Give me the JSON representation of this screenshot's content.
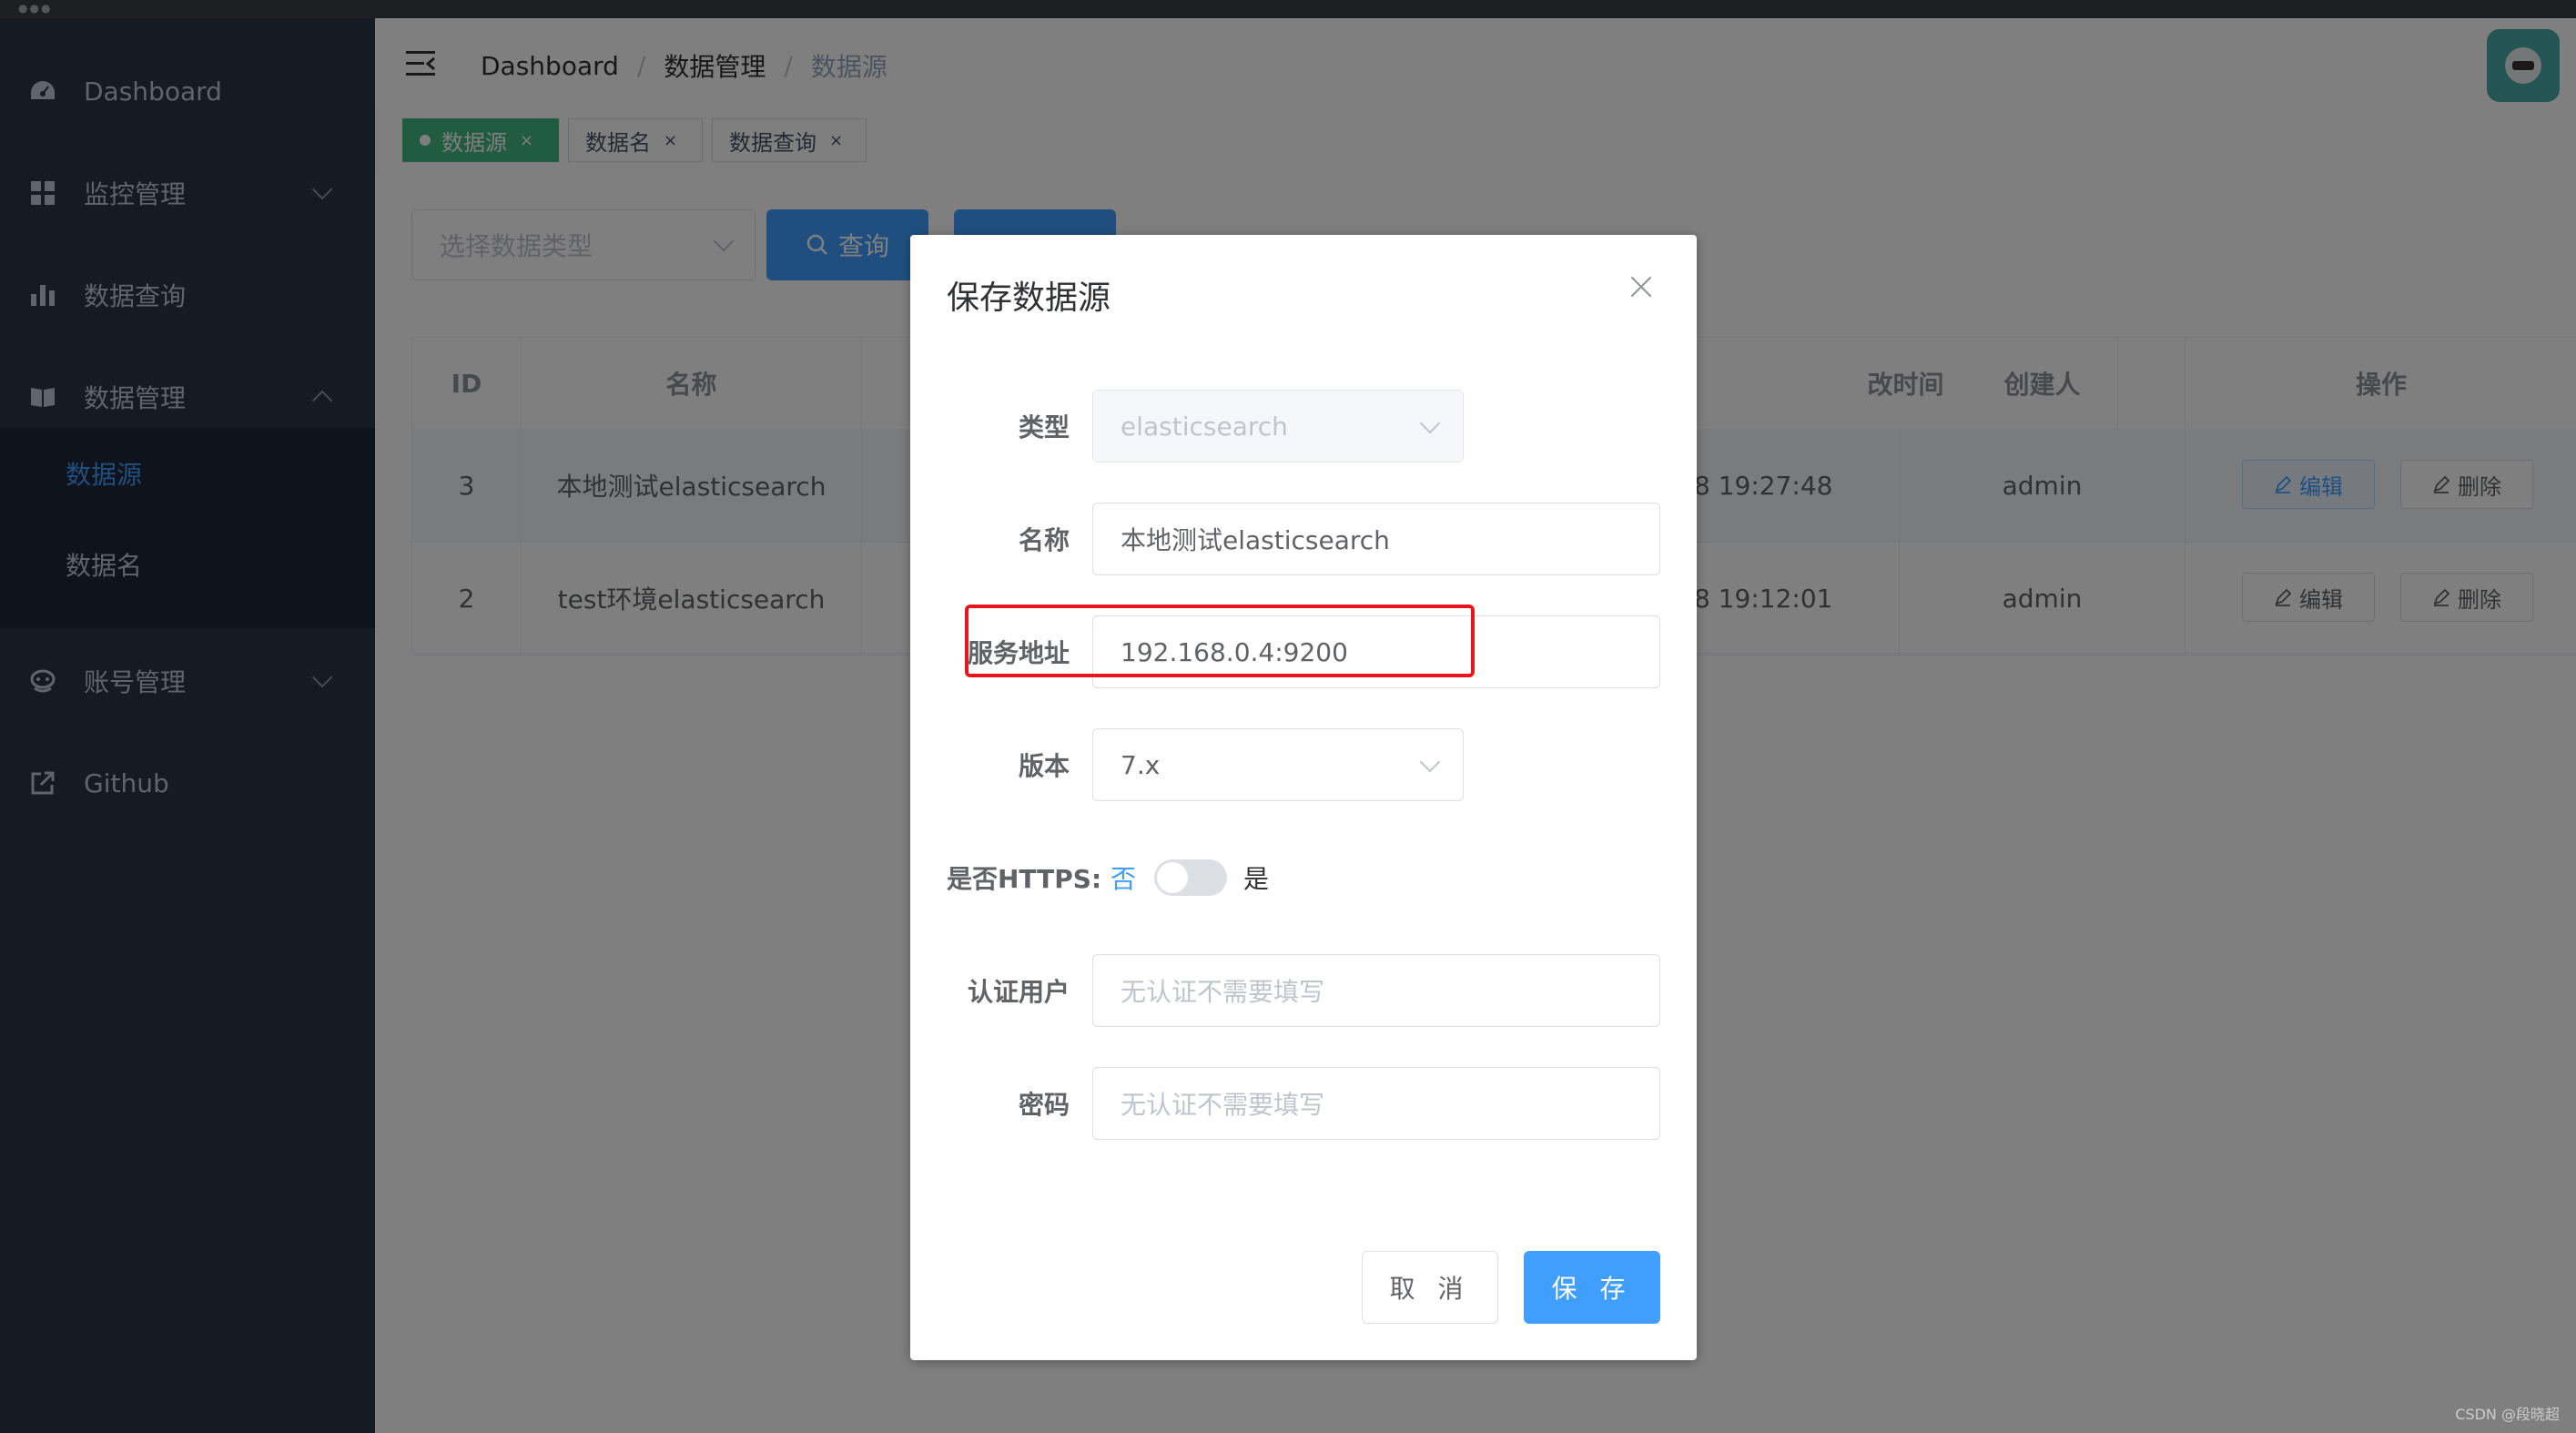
{
  "sidebar": {
    "items": [
      {
        "label": "Dashboard",
        "icon": "dashboard-icon"
      },
      {
        "label": "监控管理",
        "icon": "grid-icon"
      },
      {
        "label": "数据查询",
        "icon": "bar-chart-icon"
      },
      {
        "label": "数据管理",
        "icon": "book-icon"
      },
      {
        "label": "账号管理",
        "icon": "user-icon"
      },
      {
        "label": "Github",
        "icon": "external-link-icon"
      }
    ],
    "submenu": [
      {
        "label": "数据源",
        "active": true
      },
      {
        "label": "数据名",
        "active": false
      }
    ]
  },
  "header": {
    "breadcrumb": [
      "Dashboard",
      "数据管理",
      "数据源"
    ],
    "separator": "/"
  },
  "tags": [
    {
      "label": "数据源",
      "active": true
    },
    {
      "label": "数据名",
      "active": false
    },
    {
      "label": "数据查询",
      "active": false
    }
  ],
  "tag_close": "×",
  "filter": {
    "placeholder": "选择数据类型",
    "query_button": "查询"
  },
  "table": {
    "headers": [
      "ID",
      "名称",
      "改时间",
      "创建人",
      "操作"
    ],
    "rows": [
      {
        "id": "3",
        "name": "本地测试elasticsearch",
        "time": "8 19:27:48",
        "creator": "admin"
      },
      {
        "id": "2",
        "name": "test环境elasticsearch",
        "time": "8 19:12:01",
        "creator": "admin"
      }
    ],
    "edit_label": "编辑",
    "delete_label": "删除"
  },
  "dialog": {
    "title": "保存数据源",
    "fields": {
      "type_label": "类型",
      "type_value": "elasticsearch",
      "name_label": "名称",
      "name_value": "本地测试elasticsearch",
      "address_label": "服务地址",
      "address_value": "192.168.0.4:9200",
      "version_label": "版本",
      "version_value": "7.x",
      "https_label": "是否HTTPS:",
      "https_off": "否",
      "https_on": "是",
      "https_enabled": false,
      "user_label": "认证用户",
      "user_placeholder": "无认证不需要填写",
      "password_label": "密码",
      "password_placeholder": "无认证不需要填写"
    },
    "cancel_label": "取 消",
    "save_label": "保 存"
  },
  "watermark": "CSDN @段晓超",
  "colors": {
    "sidebar_bg": "#2b3447",
    "primary": "#409eff",
    "tag_active": "#42b983",
    "highlight": "#e8161c"
  }
}
